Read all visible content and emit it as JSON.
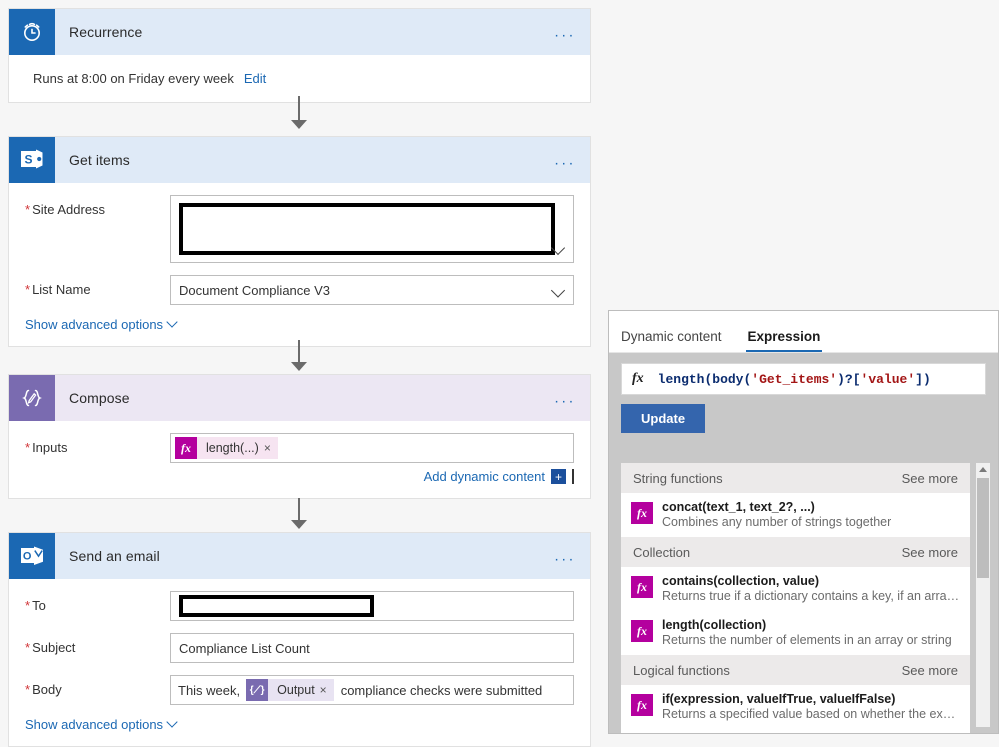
{
  "flow": {
    "steps": [
      {
        "id": "recurrence",
        "title": "Recurrence",
        "icon": "alarm-clock-icon",
        "theme": "blue",
        "menu": "...",
        "summary": "Runs at 8:00 on Friday every week",
        "edit_label": "Edit"
      },
      {
        "id": "get-items",
        "title": "Get items",
        "icon": "sharepoint-icon",
        "theme": "blue",
        "menu": "...",
        "fields": {
          "site_address_label": "Site Address",
          "site_address_value": "",
          "list_name_label": "List Name",
          "list_name_value": "Document Compliance V3"
        },
        "advanced_label": "Show advanced options"
      },
      {
        "id": "compose",
        "title": "Compose",
        "icon": "compose-braces-icon",
        "theme": "purple",
        "menu": "...",
        "fields": {
          "inputs_label": "Inputs",
          "inputs_token": "length(...)",
          "inputs_token_fx": "fx",
          "inputs_token_close": "×"
        },
        "add_dynamic_content_label": "Add dynamic content",
        "add_dynamic_content_plus": "+"
      },
      {
        "id": "send-an-email",
        "title": "Send an email",
        "icon": "outlook-icon",
        "theme": "blue",
        "menu": "...",
        "fields": {
          "to_label": "To",
          "to_value": "",
          "subject_label": "Subject",
          "subject_value": "Compliance List Count",
          "body_label": "Body",
          "body_prefix": "This week,",
          "body_token": "Output",
          "body_token_close": "×",
          "body_suffix": "compliance checks were submitted"
        },
        "advanced_label": "Show advanced options"
      }
    ]
  },
  "panel": {
    "tabs": [
      {
        "label": "Dynamic content",
        "active": false
      },
      {
        "label": "Expression",
        "active": true
      }
    ],
    "expression": {
      "fx_label": "fx",
      "full_text": "length(body('Get_items')?['value'])",
      "parts": [
        {
          "text": "length(body(",
          "kind": "fn"
        },
        {
          "text": "'Get_items'",
          "kind": "str"
        },
        {
          "text": ")?[",
          "kind": "fn"
        },
        {
          "text": "'value'",
          "kind": "str"
        },
        {
          "text": "])",
          "kind": "fn"
        }
      ]
    },
    "update_button": "Update",
    "see_more_label": "See more",
    "groups": [
      {
        "name": "String functions",
        "items": [
          {
            "signature": "concat(text_1, text_2?, ...)",
            "description": "Combines any number of strings together",
            "fx": "fx"
          }
        ]
      },
      {
        "name": "Collection",
        "items": [
          {
            "signature": "contains(collection, value)",
            "description": "Returns true if a dictionary contains a key, if an array cont...",
            "fx": "fx"
          },
          {
            "signature": "length(collection)",
            "description": "Returns the number of elements in an array or string",
            "fx": "fx"
          }
        ]
      },
      {
        "name": "Logical functions",
        "items": [
          {
            "signature": "if(expression, valueIfTrue, valueIfFalse)",
            "description": "Returns a specified value based on whether the expressio...",
            "fx": "fx"
          }
        ]
      }
    ]
  },
  "colors": {
    "accent_blue": "#1b68b3",
    "header_blue": "#dfeaf7",
    "header_purple": "#ece7f3",
    "icon_purple": "#7a6bb0",
    "fx_magenta": "#b4009e",
    "button_blue": "#3465ad",
    "required_red": "#d13438"
  }
}
